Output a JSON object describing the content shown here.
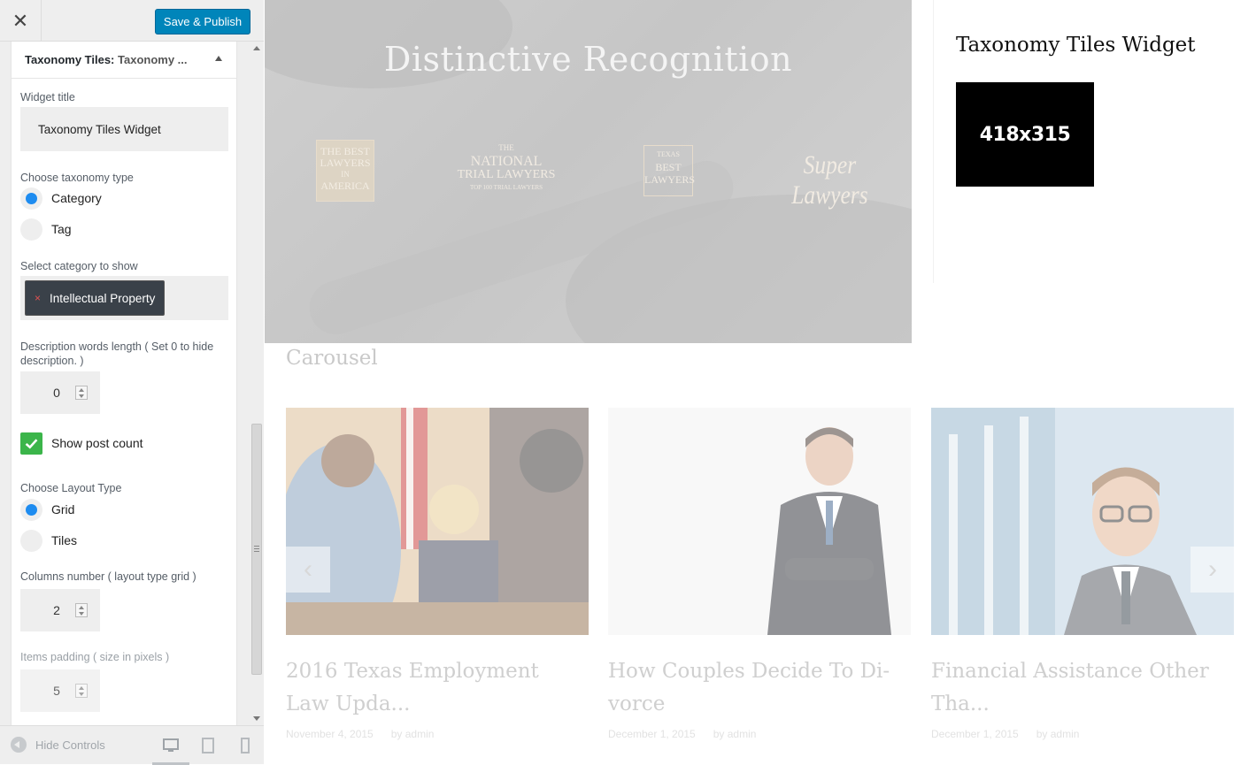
{
  "topbar": {
    "close_glyph": "✕",
    "save_label": "Save & Publish"
  },
  "panel": {
    "header_prefix": "Taxonomy Tiles:",
    "header_suffix": "Taxonomy ...",
    "widget_title_label": "Widget title",
    "widget_title_value": "Taxonomy Tiles Widget",
    "taxonomy_type_label": "Choose taxonomy type",
    "taxonomy_options": [
      {
        "label": "Category",
        "checked": true
      },
      {
        "label": "Tag",
        "checked": false
      }
    ],
    "select_category_label": "Select category to show",
    "selected_category": "Intellectual Property",
    "chip_remove_glyph": "×",
    "desc_length_label": "Description words length ( Set 0 to hide description. )",
    "desc_length_value": "0",
    "show_post_count_label": "Show post count",
    "show_post_count_checked": true,
    "layout_type_label": "Choose Layout Type",
    "layout_options": [
      {
        "label": "Grid",
        "checked": true
      },
      {
        "label": "Tiles",
        "checked": false
      }
    ],
    "columns_label": "Columns number ( layout type grid )",
    "columns_value": "2",
    "padding_label": "Items padding ( size in pixels )",
    "padding_value": "5"
  },
  "footer": {
    "hide_controls_label": "Hide Controls",
    "devices": [
      "desktop-icon",
      "tablet-icon",
      "mobile-icon"
    ],
    "active_device": "desktop"
  },
  "preview": {
    "hero_title": "Distinctive Recognition",
    "awards": {
      "award1_lines": [
        "THE BEST",
        "LAWYERS",
        "IN",
        "AMERICA"
      ],
      "award2_lines": [
        "THE",
        "NATIONAL",
        "TRIAL LAWYERS",
        "TOP 100 TRIAL LAWYERS"
      ],
      "award3_lines": [
        "TEXAS",
        "BEST",
        "LAWYERS"
      ],
      "award4_text": "Super Lawyers"
    },
    "widget_title": "Taxonomy Tiles Widget",
    "widget_tile_text": "418x315",
    "carousel_title": "Carousel",
    "prev_glyph": "‹",
    "next_glyph": "›",
    "posts": [
      {
        "title": "2016 Texas Employment Law Upda...",
        "date": "November 4, 2015",
        "author": "by admin"
      },
      {
        "title": "How Couples Decide To Di-vorce",
        "date": "December 1, 2015",
        "author": "by admin"
      },
      {
        "title": "Financial Assistance Other Tha...",
        "date": "December 1, 2015",
        "author": "by admin"
      }
    ]
  },
  "colors": {
    "primary_button": "#0085ba",
    "radio_checked": "#1e8cf0",
    "checkbox_checked": "#3bb54a",
    "chip_background": "#3a4149"
  }
}
